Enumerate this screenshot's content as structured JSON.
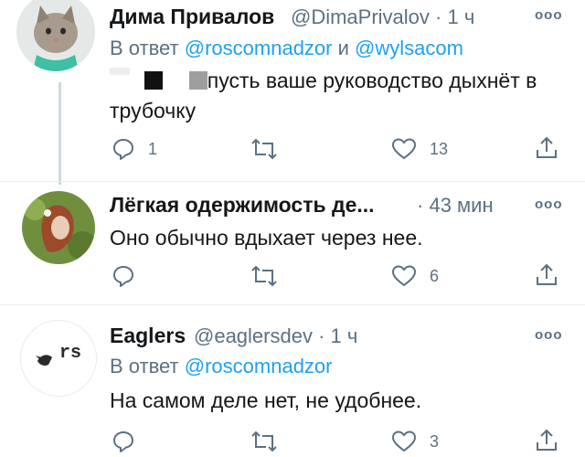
{
  "tweets": [
    {
      "name": "Дима Привалов",
      "handle": "@DimaPrivalov",
      "dot": "·",
      "time": "1 ч",
      "reply_prefix": "В ответ",
      "reply_mention_1": "@roscomnadzor",
      "reply_and": "и",
      "reply_mention_2": "@wylsacom",
      "text": "пусть ваше руководство дыхнёт в трубочку",
      "more": "ооо",
      "replies": "1",
      "retweets": "",
      "likes": "13"
    },
    {
      "name": "Лёгкая одержимость де...",
      "dot": "·",
      "time": "43 мин",
      "text": "Оно обычно вдыхает через нее.",
      "more": "ооо",
      "replies": "",
      "retweets": "",
      "likes": "6"
    },
    {
      "name": "Eaglers",
      "handle": "@eaglersdev",
      "dot": "·",
      "time": "1 ч",
      "reply_prefix": "В ответ",
      "reply_mention_1": "@roscomnadzor",
      "avatar_text": "rs",
      "text": "На самом деле нет, не удобнее.",
      "more": "ооо",
      "replies": "",
      "retweets": "",
      "likes": "3"
    }
  ],
  "colors": {
    "text": "#14171a",
    "secondary": "#5b7083",
    "link": "#1da1f2",
    "divider": "#e6ecf0",
    "thread_line": "#cfd9de"
  },
  "icons": [
    "reply-icon",
    "retweet-icon",
    "like-icon",
    "share-icon",
    "more-icon"
  ]
}
